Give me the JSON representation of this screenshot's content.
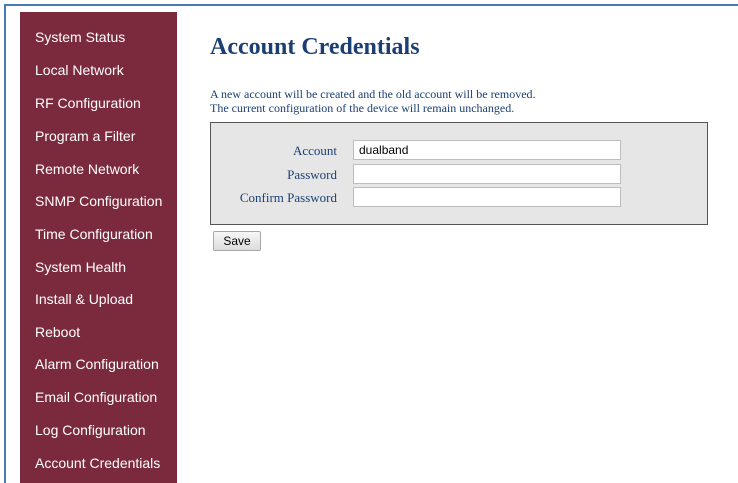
{
  "sidebar": {
    "items": [
      {
        "label": "System Status"
      },
      {
        "label": "Local Network"
      },
      {
        "label": "RF Configuration"
      },
      {
        "label": "Program a Filter"
      },
      {
        "label": "Remote Network"
      },
      {
        "label": "SNMP Configuration"
      },
      {
        "label": "Time Configuration"
      },
      {
        "label": "System Health"
      },
      {
        "label": "Install & Upload"
      },
      {
        "label": "Reboot"
      },
      {
        "label": "Alarm Configuration"
      },
      {
        "label": "Email Configuration"
      },
      {
        "label": "Log Configuration"
      },
      {
        "label": "Account Credentials"
      }
    ],
    "active": "Account Credentials"
  },
  "main": {
    "title": "Account Credentials",
    "notes": [
      "A new account will be created and the old account will be removed.",
      "The current configuration of the device will remain unchanged."
    ],
    "form": {
      "fields": [
        {
          "label": "Account",
          "value": "dualband",
          "placeholder": ""
        },
        {
          "label": "Password",
          "value": "",
          "placeholder": ""
        },
        {
          "label": "Confirm Password",
          "value": "",
          "placeholder": ""
        }
      ]
    },
    "save_label": "Save"
  },
  "colors": {
    "sidebar_bg": "#7a2a3c",
    "heading": "#1c3f73",
    "form_bg": "#e6e6e6",
    "frame_border": "#4a7ab5"
  }
}
